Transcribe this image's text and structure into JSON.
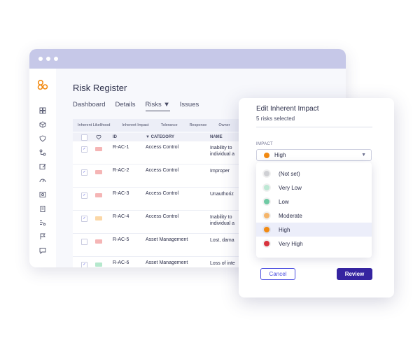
{
  "sidebar": {
    "icons": [
      "dashboard-icon",
      "cube-icon",
      "shield-icon",
      "workflow-icon",
      "edit-icon",
      "gauge-icon",
      "image-icon",
      "clipboard-icon",
      "list-icon",
      "flag-icon",
      "chat-icon"
    ]
  },
  "page": {
    "title": "Risk Register"
  },
  "tabs": [
    {
      "label": "Dashboard"
    },
    {
      "label": "Details"
    },
    {
      "label": "Risks ▼"
    },
    {
      "label": "Issues"
    }
  ],
  "subtabs": [
    "Inherent Likelihood",
    "Inherent Impact",
    "Tolerance",
    "Response",
    "Owner"
  ],
  "table": {
    "headers": {
      "id": "ID",
      "category": "▼ CATEGORY",
      "name": "NAME"
    },
    "rows": [
      {
        "id": "R-AC-1",
        "category": "Access Control",
        "name": "Inability to\nindividual a",
        "checked": true,
        "badge": "#f5b5b5"
      },
      {
        "id": "R-AC-2",
        "category": "Access Control",
        "name": "Improper",
        "checked": true,
        "badge": "#f5b5b5"
      },
      {
        "id": "R-AC-3",
        "category": "Access Control",
        "name": "Unauthoriz",
        "checked": true,
        "badge": "#f5b5b5"
      },
      {
        "id": "R-AC-4",
        "category": "Access Control",
        "name": "Inability to\nindividual a",
        "checked": true,
        "badge": "#fbd7a6"
      },
      {
        "id": "R-AC-5",
        "category": "Asset Management",
        "name": "Lost, dama",
        "checked": false,
        "badge": "#f5b5b5"
      },
      {
        "id": "R-AC-6",
        "category": "Asset Management",
        "name": "Loss of inte",
        "checked": true,
        "badge": "#b5e8cd"
      }
    ]
  },
  "modal": {
    "title": "Edit Inherent Impact",
    "subtitle": "5 risks selected",
    "impact_label": "IMPACT",
    "selected": {
      "label": "High",
      "color": "#f28a12"
    },
    "options": [
      {
        "label": "(Not set)",
        "color": "#cfd0d4"
      },
      {
        "label": "Very Low",
        "color": "#bde8d4"
      },
      {
        "label": "Low",
        "color": "#6fcaa4"
      },
      {
        "label": "Moderate",
        "color": "#f5b56a"
      },
      {
        "label": "High",
        "color": "#f28a12"
      },
      {
        "label": "Very High",
        "color": "#d8333d"
      }
    ],
    "highlighted_index": 4,
    "cancel_label": "Cancel",
    "review_label": "Review"
  },
  "colors": {
    "accent": "#3524a0",
    "link": "#4a4de0",
    "logo": "#f28a12",
    "titlebar": "#c6c8e8"
  }
}
